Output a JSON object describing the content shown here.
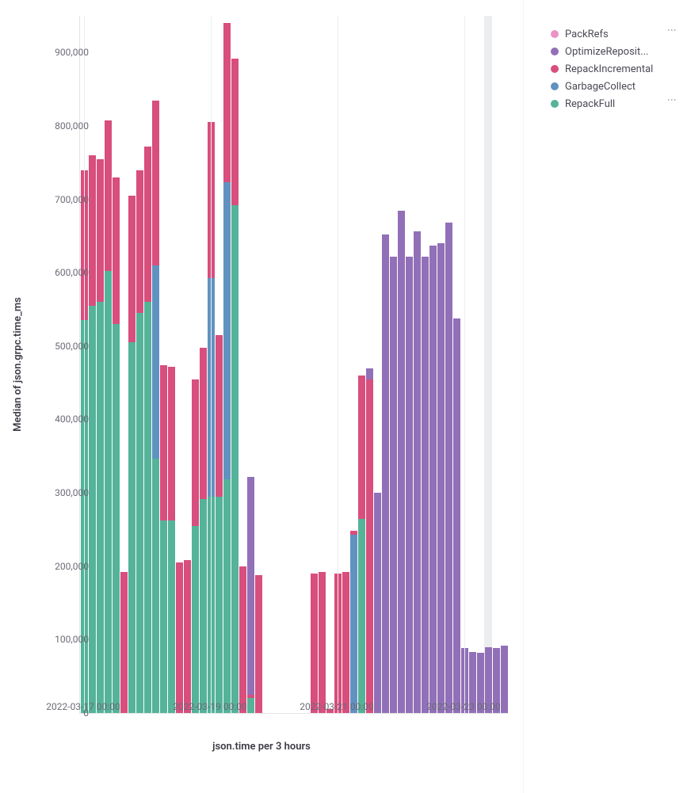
{
  "chart_data": {
    "type": "bar",
    "stacked": true,
    "ylabel": "Median of json.grpc.time_ms",
    "xlabel": "json.time per 3 hours",
    "ylim": [
      0,
      950000
    ],
    "yticks": [
      0,
      100000,
      200000,
      300000,
      400000,
      500000,
      600000,
      700000,
      800000,
      900000
    ],
    "ytick_labels": [
      "0",
      "100,000",
      "200,000",
      "300,000",
      "400,000",
      "500,000",
      "600,000",
      "700,000",
      "800,000",
      "900,000"
    ],
    "xticks_indices": [
      0,
      16,
      32,
      48
    ],
    "xtick_labels": [
      "2022-03-17 00:00",
      "2022-03-19 00:00",
      "2022-03-21 00:00",
      "2022-03-23 00:00"
    ],
    "legend": [
      {
        "name": "PackRefs",
        "color": "#ec92c5"
      },
      {
        "name": "OptimizeReposit...",
        "color": "#9170b8"
      },
      {
        "name": "RepackIncremental",
        "color": "#d84e7d"
      },
      {
        "name": "GarbageCollect",
        "color": "#6092c0"
      },
      {
        "name": "RepackFull",
        "color": "#54b399"
      }
    ],
    "series_order": [
      "RepackFull",
      "GarbageCollect",
      "RepackIncremental",
      "OptimizeRepository",
      "PackRefs"
    ],
    "colors": {
      "RepackFull": "#54b399",
      "GarbageCollect": "#6092c0",
      "RepackIncremental": "#d84e7d",
      "OptimizeRepository": "#9170b8",
      "PackRefs": "#ec92c5"
    },
    "highlight_index": 51,
    "bars": [
      {
        "i": 0,
        "RepackFull": 535000,
        "RepackIncremental": 205000
      },
      {
        "i": 1,
        "RepackFull": 555000,
        "RepackIncremental": 205000
      },
      {
        "i": 2,
        "RepackFull": 560000,
        "RepackIncremental": 195000
      },
      {
        "i": 3,
        "RepackFull": 602000,
        "RepackIncremental": 205000
      },
      {
        "i": 4,
        "RepackFull": 530000,
        "RepackIncremental": 200000
      },
      {
        "i": 5,
        "RepackIncremental": 192000
      },
      {
        "i": 6,
        "RepackFull": 505000,
        "RepackIncremental": 200000
      },
      {
        "i": 7,
        "RepackFull": 545000,
        "RepackIncremental": 195000
      },
      {
        "i": 8,
        "RepackFull": 560000,
        "RepackIncremental": 212000
      },
      {
        "i": 9,
        "RepackFull": 347000,
        "GarbageCollect": 263000,
        "RepackIncremental": 225000
      },
      {
        "i": 10,
        "RepackFull": 262000,
        "RepackIncremental": 212000
      },
      {
        "i": 11,
        "RepackFull": 262000,
        "RepackIncremental": 210000
      },
      {
        "i": 12,
        "RepackIncremental": 205000
      },
      {
        "i": 13,
        "RepackIncremental": 208000
      },
      {
        "i": 14,
        "RepackFull": 255000,
        "RepackIncremental": 200000
      },
      {
        "i": 15,
        "RepackFull": 292000,
        "RepackIncremental": 206000
      },
      {
        "i": 16,
        "RepackFull": 295000,
        "GarbageCollect": 298000,
        "RepackIncremental": 212000
      },
      {
        "i": 17,
        "RepackFull": 295000,
        "RepackIncremental": 220000
      },
      {
        "i": 18,
        "RepackFull": 318000,
        "GarbageCollect": 405000,
        "RepackIncremental": 217000
      },
      {
        "i": 19,
        "RepackFull": 692000,
        "RepackIncremental": 200000
      },
      {
        "i": 20,
        "RepackIncremental": 200000
      },
      {
        "i": 21,
        "RepackFull": 20000,
        "RepackIncremental": 5000,
        "OptimizeRepository": 297000
      },
      {
        "i": 22,
        "RepackIncremental": 188000
      },
      {
        "i": 29,
        "RepackIncremental": 190000
      },
      {
        "i": 30,
        "RepackIncremental": 192000
      },
      {
        "i": 31,
        "RepackIncremental": 5000
      },
      {
        "i": 32,
        "RepackIncremental": 190000
      },
      {
        "i": 33,
        "RepackIncremental": 192000
      },
      {
        "i": 34,
        "GarbageCollect": 243000,
        "RepackIncremental": 5000
      },
      {
        "i": 35,
        "RepackFull": 265000,
        "RepackIncremental": 195000
      },
      {
        "i": 36,
        "RepackIncremental": 455000,
        "OptimizeRepository": 15000
      },
      {
        "i": 37,
        "OptimizeRepository": 300000
      },
      {
        "i": 38,
        "OptimizeRepository": 652000
      },
      {
        "i": 39,
        "OptimizeRepository": 622000
      },
      {
        "i": 40,
        "OptimizeRepository": 684000
      },
      {
        "i": 41,
        "OptimizeRepository": 622000
      },
      {
        "i": 42,
        "OptimizeRepository": 656000
      },
      {
        "i": 43,
        "OptimizeRepository": 622000
      },
      {
        "i": 44,
        "OptimizeRepository": 637000
      },
      {
        "i": 45,
        "OptimizeRepository": 640000
      },
      {
        "i": 46,
        "OptimizeRepository": 668000
      },
      {
        "i": 47,
        "OptimizeRepository": 538000
      },
      {
        "i": 48,
        "OptimizeRepository": 88000
      },
      {
        "i": 49,
        "OptimizeRepository": 83000
      },
      {
        "i": 50,
        "OptimizeRepository": 82000
      },
      {
        "i": 51,
        "OptimizeRepository": 90000
      },
      {
        "i": 52,
        "OptimizeRepository": 89000
      },
      {
        "i": 53,
        "OptimizeRepository": 92000
      }
    ],
    "num_slots": 54
  },
  "menu_glyph": "⋮"
}
